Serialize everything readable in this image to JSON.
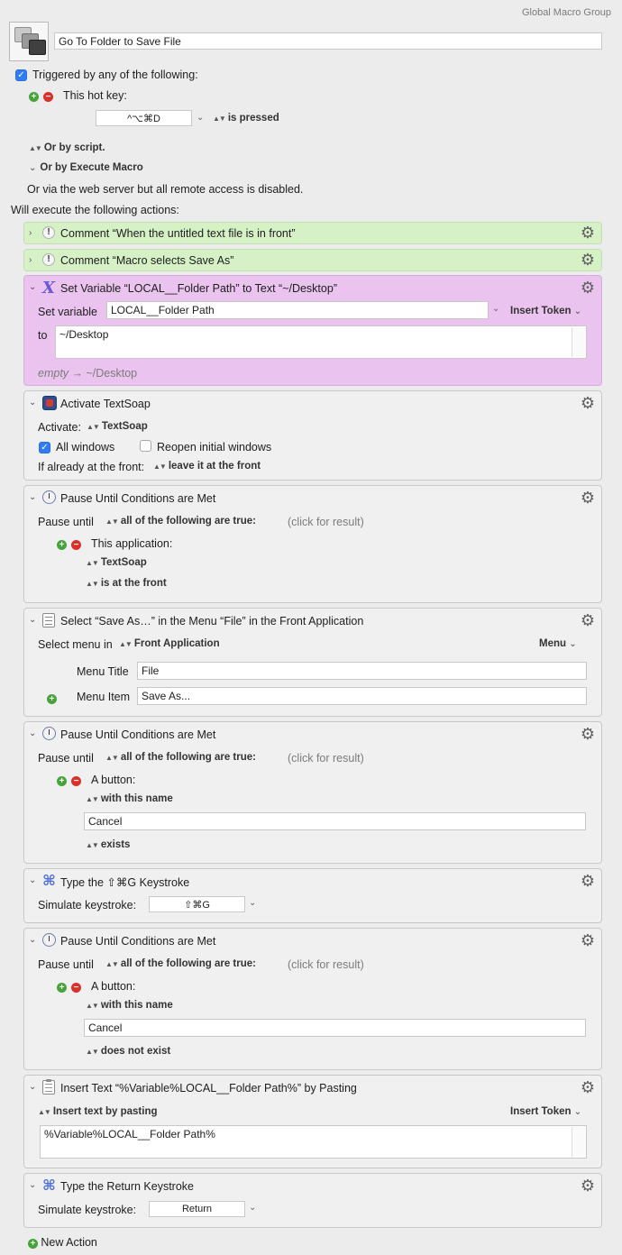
{
  "header": {
    "group_label": "Global Macro Group",
    "macro_name": "Go To Folder to Save File"
  },
  "triggers": {
    "triggered_label": "Triggered by any of the following:",
    "hotkey_label": "This hot key:",
    "hotkey_value": "^⌥⌘D",
    "hotkey_state": "is pressed",
    "or_script": "Or by script.",
    "or_execute": "Or by Execute Macro",
    "web_server": "Or via the web server but all remote access is disabled.",
    "will_execute": "Will execute the following actions:"
  },
  "actions": {
    "comment1": {
      "title": "Comment “When the untitled text file is in front”"
    },
    "comment2": {
      "title": "Comment “Macro selects Save As”"
    },
    "setvar": {
      "title": "Set Variable “LOCAL__Folder Path” to Text “~/Desktop”",
      "set_label": "Set variable",
      "var_value": "LOCAL__Folder Path",
      "insert_token": "Insert Token",
      "to_label": "to",
      "to_value": "~/Desktop",
      "result_empty": "empty",
      "result_arrow": "→ ~/Desktop"
    },
    "activate": {
      "title": "Activate TextSoap",
      "activate_label": "Activate:",
      "app": "TextSoap",
      "all_windows": "All windows",
      "reopen": "Reopen initial windows",
      "front_label": "If already at the front:",
      "front_value": "leave it at the front"
    },
    "pause1": {
      "title": "Pause Until Conditions are Met",
      "pause_label": "Pause until",
      "cond": "all of the following are true:",
      "result": "(click for result)",
      "app_label": "This application:",
      "app": "TextSoap",
      "state": "is at the front"
    },
    "selectmenu": {
      "title": "Select “Save As…” in the Menu “File” in the Front Application",
      "select_label": "Select menu in",
      "target": "Front Application",
      "menu": "Menu",
      "title_label": "Menu Title",
      "title_value": "File",
      "item_label": "Menu Item",
      "item_value": "Save As..."
    },
    "pause2": {
      "title": "Pause Until Conditions are Met",
      "pause_label": "Pause until",
      "cond": "all of the following are true:",
      "result": "(click for result)",
      "button_label": "A button:",
      "match": "with this name",
      "name": "Cancel",
      "state": "exists"
    },
    "keystroke1": {
      "title": "Type the ⇧⌘G Keystroke",
      "sim_label": "Simulate keystroke:",
      "key": "⇧⌘G"
    },
    "pause3": {
      "title": "Pause Until Conditions are Met",
      "pause_label": "Pause until",
      "cond": "all of the following are true:",
      "result": "(click for result)",
      "button_label": "A button:",
      "match": "with this name",
      "name": "Cancel",
      "state": "does not exist"
    },
    "inserttext": {
      "title": "Insert Text “%Variable%LOCAL__Folder Path%” by Pasting",
      "mode": "Insert text by pasting",
      "insert_token": "Insert Token",
      "text": "%Variable%LOCAL__Folder Path%"
    },
    "keystroke2": {
      "title": "Type the Return Keystroke",
      "sim_label": "Simulate keystroke:",
      "key": "Return"
    }
  },
  "footer": {
    "new_action": "New Action"
  },
  "colors": {
    "comment_bg": "#d7f1c7",
    "variable_bg": "#eac3ef",
    "accent": "#2f7cf6"
  },
  "icons": [
    "macro-keys-icon",
    "comment-icon",
    "variable-x-icon",
    "textsoap-icon",
    "clock-icon",
    "menu-icon",
    "command-icon",
    "paste-icon",
    "gear-icon"
  ]
}
